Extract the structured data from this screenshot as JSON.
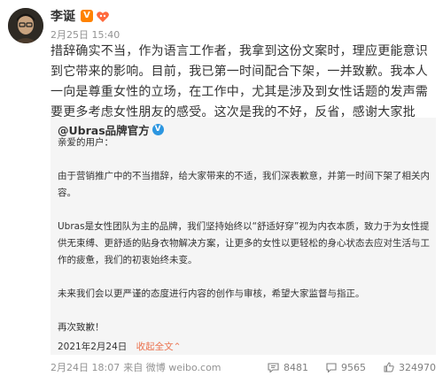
{
  "post": {
    "author": "李诞",
    "meta": "2月25日 15:40",
    "text": "措辞确实不当，作为语言工作者，我拿到这份文案时，理应更能意识到它带来的影响。目前，我已第一时间配合下架，一并致歉。我本人一向是尊重女性的立场，在工作中，尤其是涉及到女性话题的发声需要更多考虑女性朋友的感受。这次是我的不好，反省，感谢大家批评。"
  },
  "repost": {
    "author": "@Ubras品牌官方",
    "greeting": "亲爱的用户：",
    "paragraphs": [
      "由于营销推广中的不当措辞，给大家带来的不适，我们深表歉意，并第一时间下架了相关内容。",
      "Ubras是女性团队为主的品牌，我们坚持始终以“舒适好穿”视为内衣本质，致力于为女性提供无束缚、更舒适的贴身衣物解决方案，让更多的女性以更轻松的身心状态去应对生活与工作的疲惫，我们的初衷始终未变。",
      "未来我们会以更严谨的态度进行内容的创作与审核，希望大家监督与指正。",
      "再次致歉！"
    ],
    "date": "2021年2月24日",
    "collapse": "收起全文",
    "collapse_arrow": "⌃",
    "time": "2月24日 18:07",
    "source": "来自 微博 weibo.com",
    "reposts": "8481",
    "comments": "9565",
    "likes": "324970"
  },
  "icons": [
    "vip-v-icon",
    "heart-icon",
    "verified-v-icon",
    "repost-icon",
    "comment-icon",
    "like-icon"
  ],
  "colors": {
    "link": "#eb7350",
    "vip": "#ff8200",
    "verified": "#2c96e0",
    "repost_bg": "#f5f5f5",
    "meta": "#939393"
  }
}
